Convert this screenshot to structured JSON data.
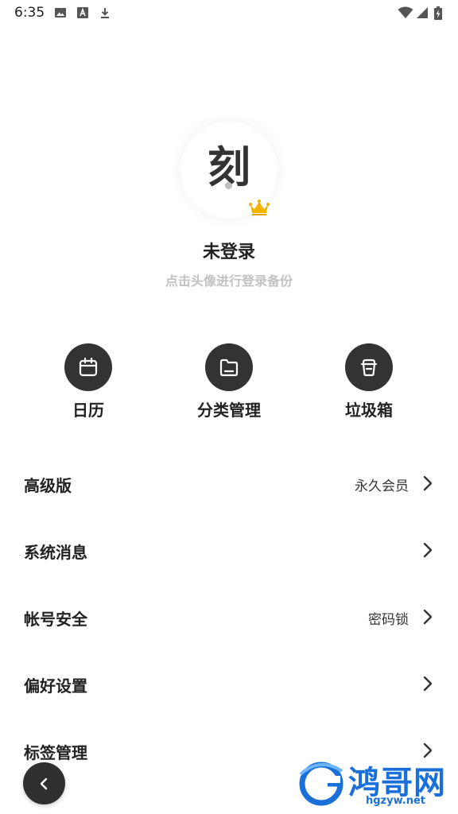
{
  "status_bar": {
    "time": "6:35",
    "left_icons": [
      "image-icon",
      "font-a-icon",
      "download-icon"
    ],
    "right_icons": [
      "wifi-icon",
      "signal-icon",
      "battery-charging-icon"
    ]
  },
  "profile": {
    "avatar_glyph": "刻",
    "badge_icon": "crown-icon",
    "name": "未登录",
    "hint": "点击头像进行登录备份"
  },
  "quick_actions": [
    {
      "label": "日历",
      "icon": "calendar-icon"
    },
    {
      "label": "分类管理",
      "icon": "folder-icon"
    },
    {
      "label": "垃圾箱",
      "icon": "trash-icon"
    }
  ],
  "menu": [
    {
      "label": "高级版",
      "value": "永久会员"
    },
    {
      "label": "系统消息",
      "value": ""
    },
    {
      "label": "帐号安全",
      "value": "密码锁"
    },
    {
      "label": "偏好设置",
      "value": ""
    },
    {
      "label": "标签管理",
      "value": ""
    }
  ],
  "back_button": {
    "icon": "chevron-left-icon"
  },
  "watermark": {
    "text": "鸿哥网",
    "url": "hgzyw.net"
  },
  "colors": {
    "accent_dark": "#333333",
    "hint_gray": "#c2c2c2",
    "crown_gold": "#f2b400",
    "watermark_blue": "#1a6fd8"
  }
}
